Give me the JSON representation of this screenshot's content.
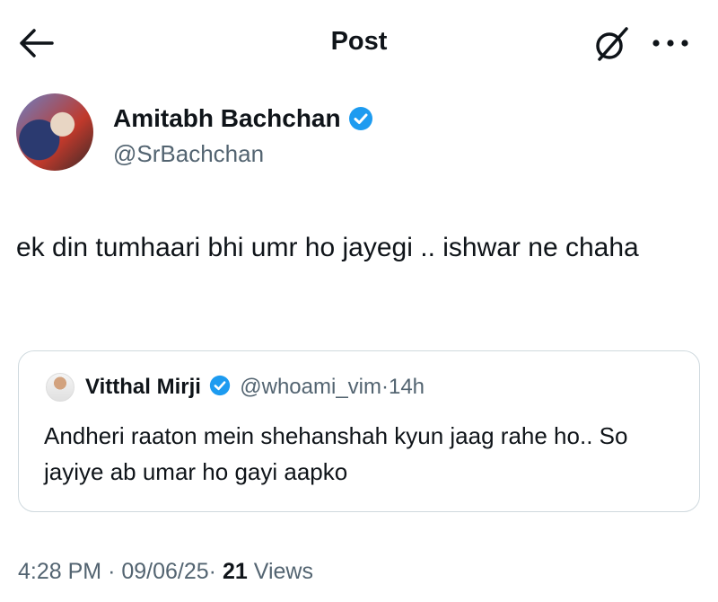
{
  "header": {
    "title": "Post"
  },
  "post": {
    "author_name": "Amitabh Bachchan",
    "author_handle": "@SrBachchan",
    "text": "ek din tumhaari bhi umr ho jayegi .. ishwar ne chaha"
  },
  "quote": {
    "author_name": "Vitthal Mirji",
    "author_handle": "@whoami_vim",
    "separator": "·",
    "age": "14h",
    "text": "Andheri raaton mein shehanshah kyun jaag rahe ho.. So jayiye ab umar ho gayi aapko"
  },
  "footer": {
    "time": "4:28 PM",
    "separator": "·",
    "date": "09/06/25",
    "views_count": "21",
    "views_label": "Views"
  },
  "colors": {
    "verified_blue": "#1d9bf0",
    "muted_text": "#536471",
    "text": "#0f1419"
  },
  "icons": [
    "back-arrow-icon",
    "grok-icon",
    "more-icon",
    "verified-badge-icon"
  ]
}
